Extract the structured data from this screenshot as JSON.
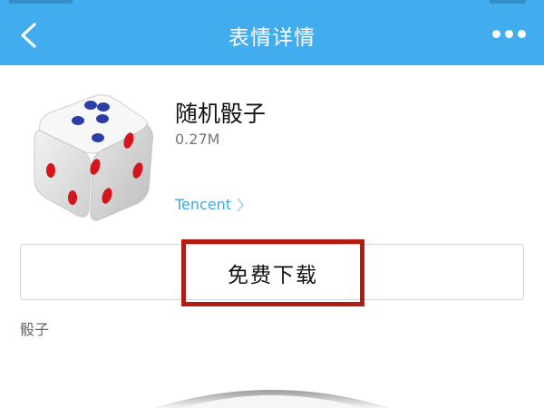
{
  "header": {
    "title": "表情详情",
    "background_color": "#42adee",
    "back_icon": "chevron-left-icon",
    "more_icon": "more-dots-icon"
  },
  "pack": {
    "title": "随机骰子",
    "size": "0.27M",
    "author": "Tencent",
    "thumbnail_icon": "dice-icon"
  },
  "actions": {
    "download_label": "免费下载",
    "highlight_color": "#b21c14"
  },
  "tags": {
    "label": "骰子"
  }
}
